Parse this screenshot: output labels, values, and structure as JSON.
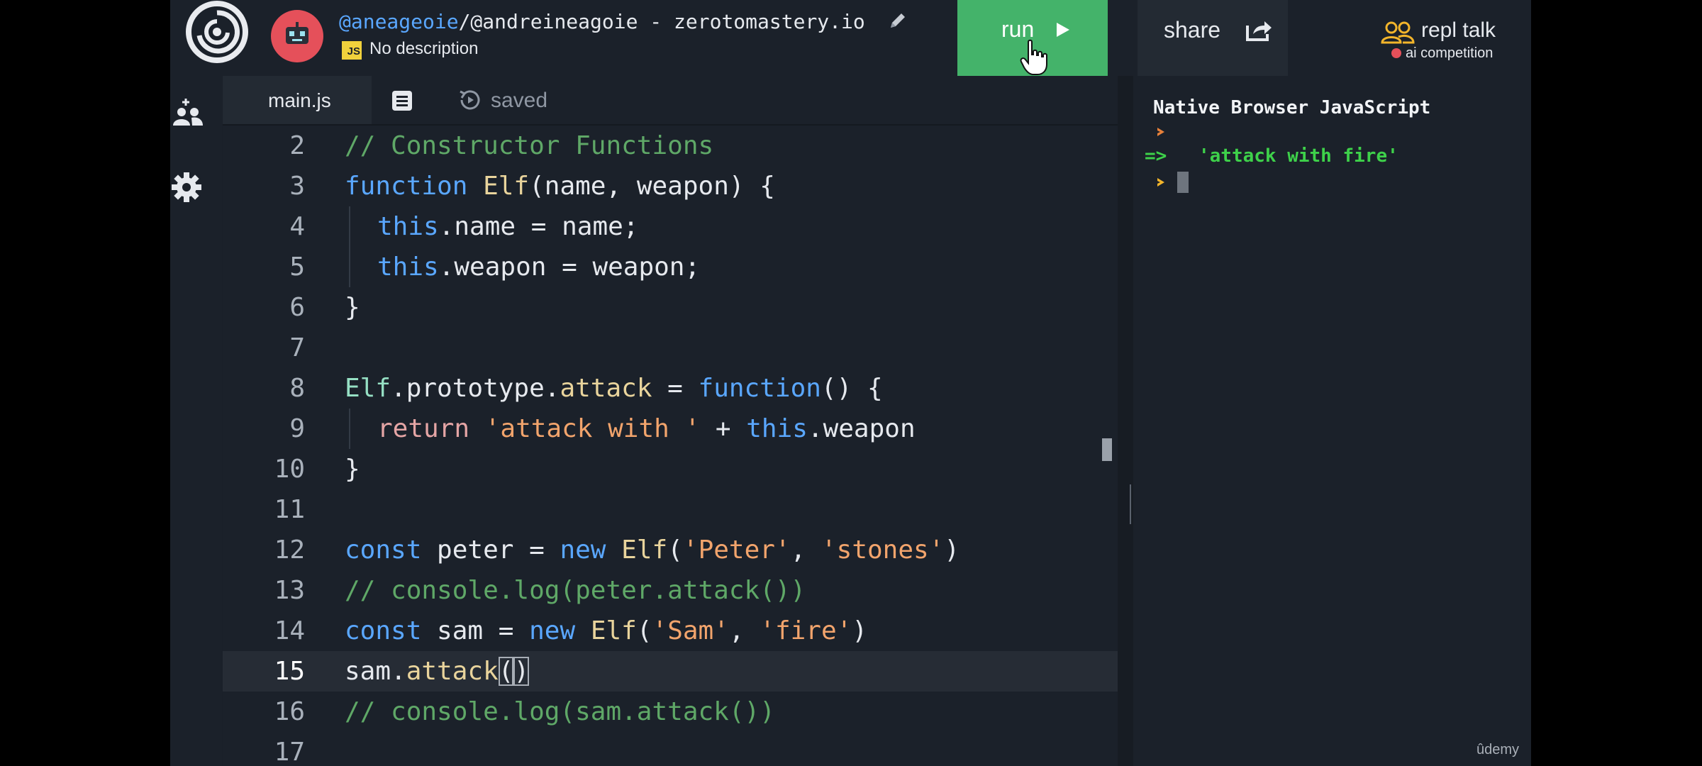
{
  "header": {
    "repl_user": "@aneageoie",
    "repl_path": "/@andreineagoie - zerotomastery.io",
    "lang_badge": "JS",
    "description": "No description",
    "run_label": "run",
    "share_label": "share",
    "repl_talk_label": "repl talk",
    "repl_talk_sub": "ai competition"
  },
  "editor": {
    "tab_label": "main.js",
    "saved_label": "saved",
    "active_line": "15",
    "lines": [
      {
        "n": "2"
      },
      {
        "n": "3"
      },
      {
        "n": "4"
      },
      {
        "n": "5"
      },
      {
        "n": "6"
      },
      {
        "n": "7"
      },
      {
        "n": "8"
      },
      {
        "n": "9"
      },
      {
        "n": "10"
      },
      {
        "n": "11"
      },
      {
        "n": "12"
      },
      {
        "n": "13"
      },
      {
        "n": "14"
      },
      {
        "n": "15"
      },
      {
        "n": "16"
      },
      {
        "n": "17"
      }
    ],
    "tokens": {
      "l2": [
        "// Constructor Functions"
      ],
      "l3": [
        "function",
        " ",
        "Elf",
        "(name, weapon) {"
      ],
      "l4": [
        "this",
        ".name = name;"
      ],
      "l5": [
        "this",
        ".weapon = weapon;"
      ],
      "l6": [
        "}"
      ],
      "l8": [
        "Elf",
        ".prototype.",
        "attack",
        " = ",
        "function",
        "() {"
      ],
      "l9": [
        "return",
        " ",
        "'attack with '",
        " + ",
        "this",
        ".weapon"
      ],
      "l10": [
        "}"
      ],
      "l12": [
        "const",
        " peter = ",
        "new",
        " ",
        "Elf",
        "(",
        "'Peter'",
        ", ",
        "'stones'",
        ")"
      ],
      "l13": [
        "// console.log(peter.attack())"
      ],
      "l14": [
        "const",
        " sam = ",
        "new",
        " ",
        "Elf",
        "(",
        "'Sam'",
        ", ",
        "'fire'",
        ")"
      ],
      "l15": [
        "sam.",
        "attack",
        "(",
        ")"
      ],
      "l16": [
        "// console.log(sam.attack())"
      ]
    }
  },
  "console": {
    "title": "Native Browser JavaScript",
    "arrow": "=>",
    "result": "'attack with fire'"
  },
  "watermark": "ûdemy",
  "colors": {
    "run_button": "#44b36a",
    "comment": "#5fa867",
    "keyword": "#5aa7ff",
    "string": "#f2a46c",
    "console_output": "#3ed14a",
    "avatar": "#e5505a",
    "js_badge": "#f1d13c"
  },
  "icons": [
    "repl-logo-icon",
    "avatar-icon",
    "edit-pencil-icon",
    "play-icon",
    "pointer-hand-icon",
    "share-icon",
    "people-icon",
    "invite-user-icon",
    "gear-icon",
    "files-icon",
    "history-icon",
    "prompt-icon"
  ]
}
